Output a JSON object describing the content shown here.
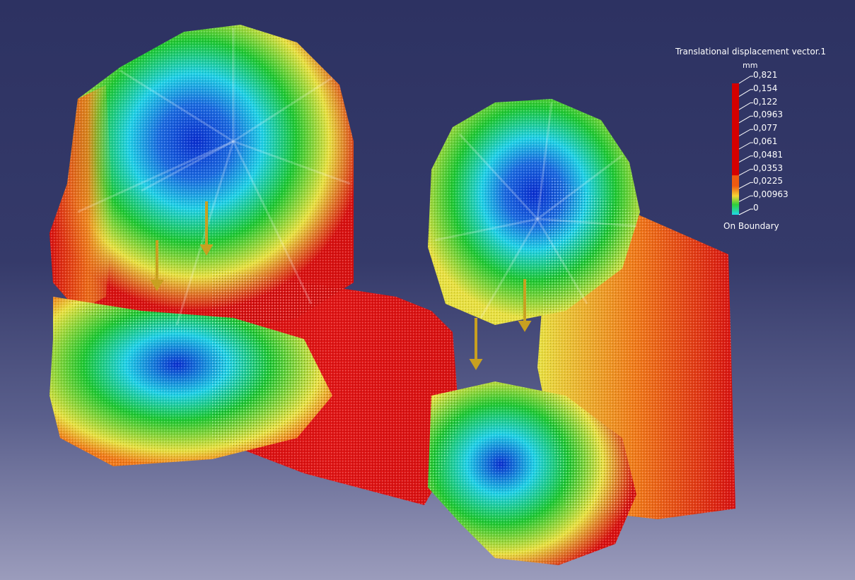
{
  "legend": {
    "title": "Translational displacement vector.1",
    "unit": "mm",
    "ticks": [
      "0,821",
      "0,154",
      "0,122",
      "0,0963",
      "0,077",
      "0,061",
      "0,0481",
      "0,0353",
      "0,0225",
      "0,00963",
      "0"
    ],
    "footer": "On Boundary",
    "colors": [
      "#d40000",
      "#d40000",
      "#d40000",
      "#d40000",
      "#d40000",
      "#d40000",
      "#d40000",
      "#ee5a10",
      "#f6d636",
      "#2fcf3a",
      "#1fd8e8"
    ]
  },
  "model": {
    "icon": "mesh-displacement-plot",
    "colors": {
      "blue": "#0a2fd0",
      "cyan": "#1fd0e6",
      "green": "#1ec832",
      "yellow": "#e8e040",
      "orange": "#f07818",
      "red": "#d81010",
      "arrow": "#c8a020"
    }
  }
}
